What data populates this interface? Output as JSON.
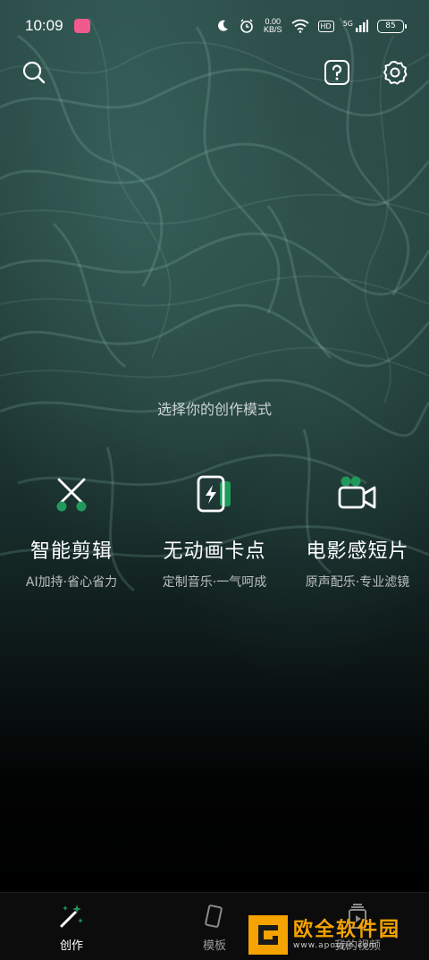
{
  "status": {
    "time": "10:09",
    "badge": "小红书",
    "speed_value": "0.00",
    "speed_unit": "KB/S",
    "hd": "HD",
    "network": "5G",
    "battery": "85"
  },
  "topbar": {
    "search_icon": "search-icon",
    "help_icon": "help-icon",
    "settings_icon": "gear-icon"
  },
  "prompt": "选择你的创作模式",
  "modes": [
    {
      "title": "智能剪辑",
      "subtitle": "AI加持·省心省力",
      "icon": "scissors-icon"
    },
    {
      "title": "无动画卡点",
      "subtitle": "定制音乐·一气呵成",
      "icon": "flash-card-icon"
    },
    {
      "title": "电影感短片",
      "subtitle": "原声配乐·专业滤镜",
      "icon": "video-camera-icon"
    }
  ],
  "tabs": [
    {
      "label": "创作",
      "icon": "magic-wand-icon",
      "active": true
    },
    {
      "label": "模板",
      "icon": "template-icon",
      "active": false
    },
    {
      "label": "我的视频",
      "icon": "video-library-icon",
      "active": false
    }
  ],
  "watermark": {
    "title": "欧全软件园",
    "url": "www.apoujin.com"
  },
  "colors": {
    "accent": "#1f9a5a",
    "watermark": "#f5a300"
  }
}
